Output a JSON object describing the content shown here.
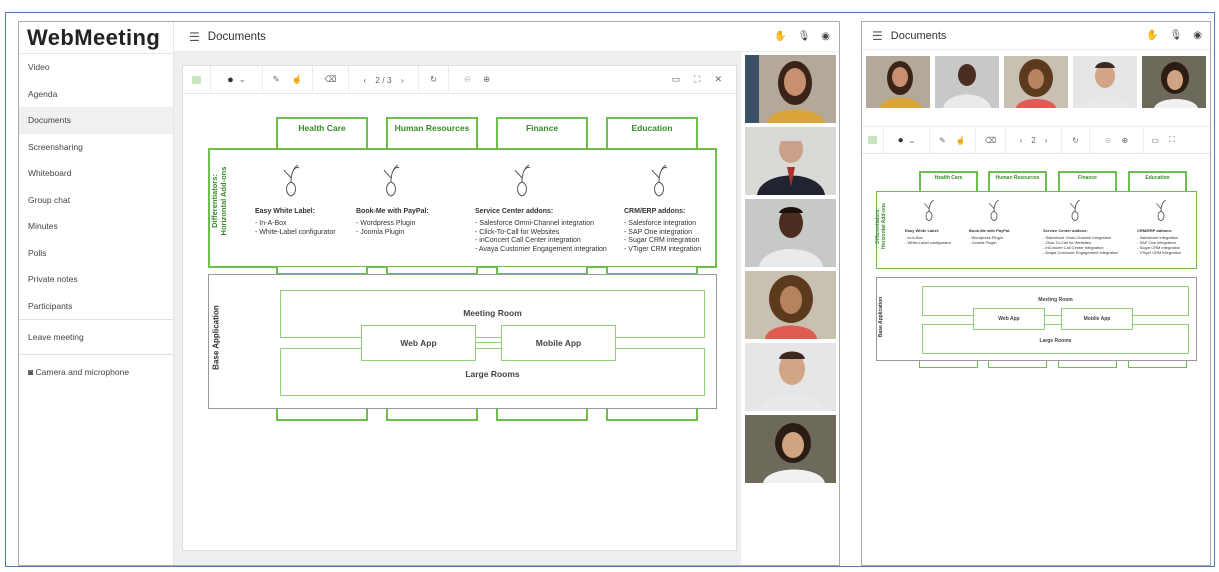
{
  "app": {
    "name": "WebMeeting",
    "page_title": "Documents"
  },
  "sidebar": {
    "items": [
      "Video",
      "Agenda",
      "Documents",
      "Screensharing",
      "Whiteboard",
      "Group chat",
      "Minutes",
      "Polls",
      "Private notes",
      "Participants"
    ],
    "leave": "Leave meeting",
    "camera": "Camera and microphone"
  },
  "toolbar": {
    "page": "2 / 3",
    "page_small": "2"
  },
  "diagram": {
    "tabs": [
      "Health Care",
      "Human Resources",
      "Finance",
      "Education"
    ],
    "diff_label_1": "Differentiators:",
    "diff_label_2": "Horizontal Add-ons",
    "addons": [
      {
        "title": "Easy White Label:",
        "items": [
          "- In-A-Box",
          "- White-Label configurator"
        ]
      },
      {
        "title": "Book-Me with PayPal:",
        "items": [
          "- Wordpress Plugin",
          "- Joomla Plugin"
        ]
      },
      {
        "title": "Service Center addons:",
        "items": [
          "- Salesforce Omni-Channel integration",
          "- Click-To-Call for Websites",
          "- inConcert Call Center integration",
          "- Avaya Customer Engagement integration"
        ]
      },
      {
        "title": "CRM/ERP addons:",
        "items": [
          "- Salesforce integration",
          "- SAP One integration",
          "- Sugar CRM integration",
          "- VTiger CRM integration"
        ]
      }
    ],
    "base_label": "Base Application",
    "meeting_room": "Meeting Room",
    "web_app": "Web App",
    "mobile_app": "Mobile App",
    "large_rooms": "Large Rooms"
  },
  "colors": {
    "accent": "#6cbf4f",
    "border": "#4a7db8"
  }
}
